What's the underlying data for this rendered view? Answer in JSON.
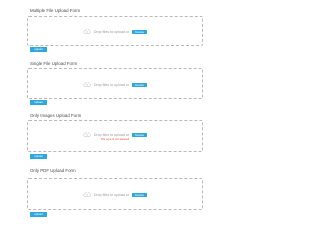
{
  "accent_color": "#2fa9dc",
  "error_color": "#e74c3c",
  "forms": [
    {
      "title": "Multiple File Upload Form",
      "drop_text": "Drop files to upload or",
      "browse_label": "browse",
      "error": "",
      "submit_label": "upload",
      "icon": "cloud-upload-icon"
    },
    {
      "title": "Single File Upload Form",
      "drop_text": "Drop files to upload or",
      "browse_label": "browse",
      "error": "",
      "submit_label": "upload",
      "icon": "cloud-upload-icon"
    },
    {
      "title": "Only Images Upload Form",
      "drop_text": "Drop files to upload or",
      "browse_label": "browse",
      "error": "File type is not allowed",
      "submit_label": "upload",
      "icon": "cloud-upload-icon"
    },
    {
      "title": "Only PDF Upload Form",
      "drop_text": "Drop files to upload or",
      "browse_label": "browse",
      "error": "",
      "submit_label": "upload",
      "icon": "cloud-upload-icon"
    }
  ]
}
